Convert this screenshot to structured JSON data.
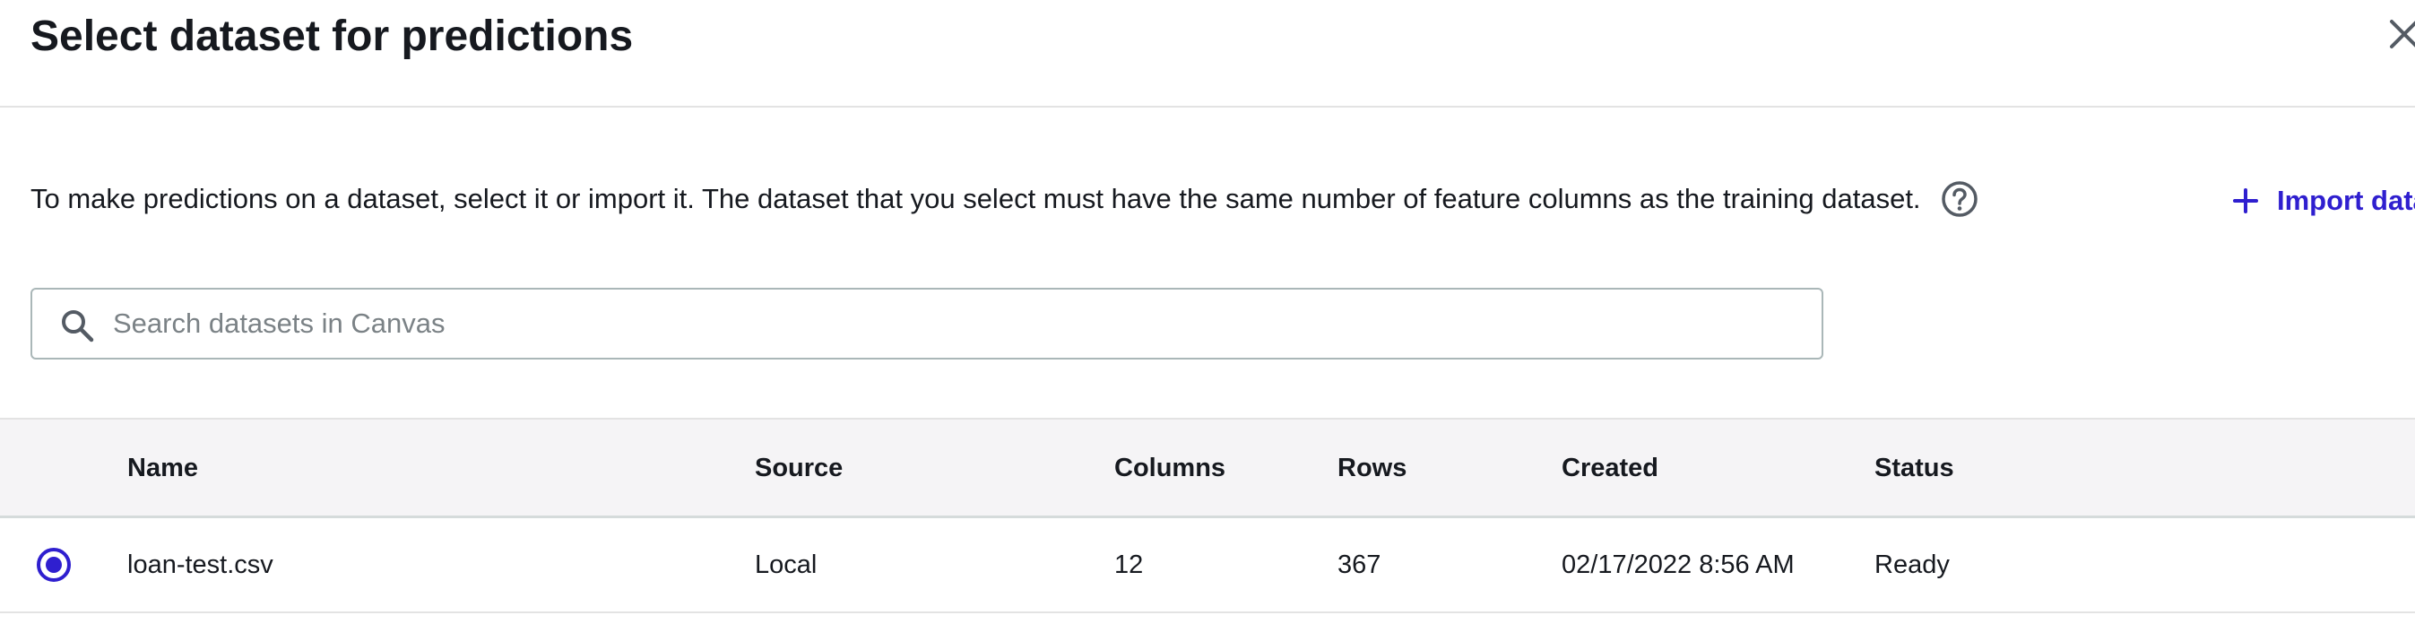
{
  "modal": {
    "title": "Select dataset for predictions",
    "close_icon": "close-icon"
  },
  "description": {
    "text": "To make predictions on a dataset, select it or import it. The dataset that you select must have the same number of feature columns as the training dataset.",
    "help_icon": "help-circle-icon"
  },
  "import": {
    "label": "Import data",
    "icon": "plus-icon"
  },
  "search": {
    "placeholder": "Search datasets in Canvas",
    "value": "",
    "icon": "search-icon"
  },
  "table": {
    "headers": {
      "name": "Name",
      "source": "Source",
      "columns": "Columns",
      "rows": "Rows",
      "created": "Created",
      "status": "Status"
    },
    "rows": [
      {
        "selected": true,
        "name": "loan-test.csv",
        "source": "Local",
        "columns": "12",
        "rows": "367",
        "created": "02/17/2022 8:56 AM",
        "status": "Ready"
      }
    ]
  },
  "colors": {
    "accent": "#2f1fcf",
    "header_bg": "#f5f4f6",
    "text": "#16191f",
    "placeholder": "#7b8286",
    "border": "#aab7b8"
  }
}
